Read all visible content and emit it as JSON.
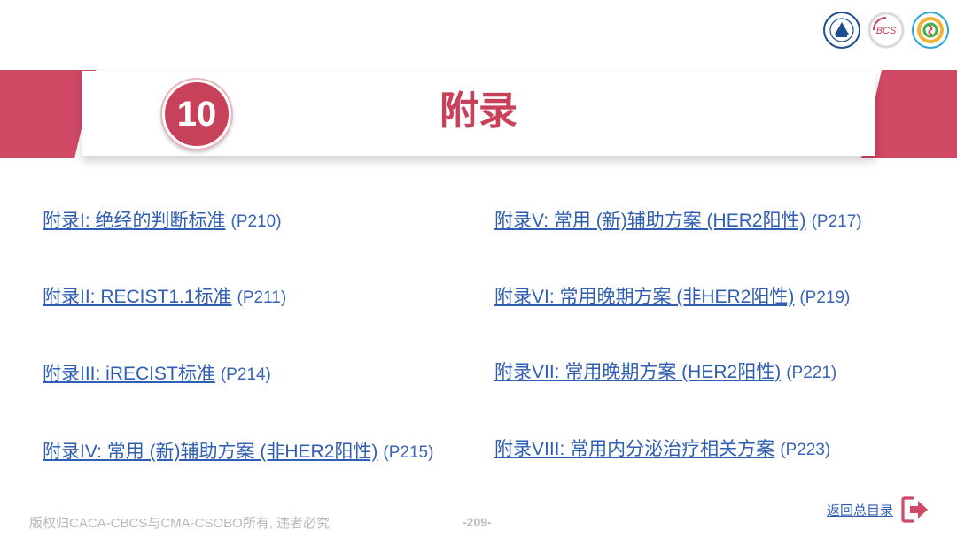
{
  "header": {
    "logos": [
      {
        "name": "university-seal-logo",
        "color": "#1b4f8f"
      },
      {
        "name": "bcs-logo",
        "text": "BCS",
        "color": "#c8415a"
      },
      {
        "name": "cso-logo",
        "color": "#2aa8d8"
      }
    ]
  },
  "section": {
    "number": "10",
    "title": "附录",
    "accent_color": "#c8415a"
  },
  "toc": {
    "left": [
      {
        "label": "附录I: 绝经的判断标准",
        "page": "(P210)"
      },
      {
        "label": "附录II: RECIST1.1标准",
        "page": "(P211)"
      },
      {
        "label": "附录III: iRECIST标准",
        "page": "(P214)"
      },
      {
        "label": "附录IV: 常用 (新)辅助方案 (非HER2阳性)",
        "page": "(P215)"
      }
    ],
    "right": [
      {
        "label": "附录V: 常用 (新)辅助方案 (HER2阳性)",
        "page": "(P217)"
      },
      {
        "label": "附录VI: 常用晚期方案 (非HER2阳性)",
        "page": "(P219)"
      },
      {
        "label": "附录VII: 常用晚期方案 (HER2阳性)",
        "page": "(P221)"
      },
      {
        "label": "附录VIII: 常用内分泌治疗相关方案",
        "page": "(P223)"
      }
    ]
  },
  "footer": {
    "copyright": "版权归CACA-CBCS与CMA-CSOBO所有, 违者必究",
    "page_number": "-209-",
    "back_label": "返回总目录",
    "back_icon": "exit-icon"
  }
}
